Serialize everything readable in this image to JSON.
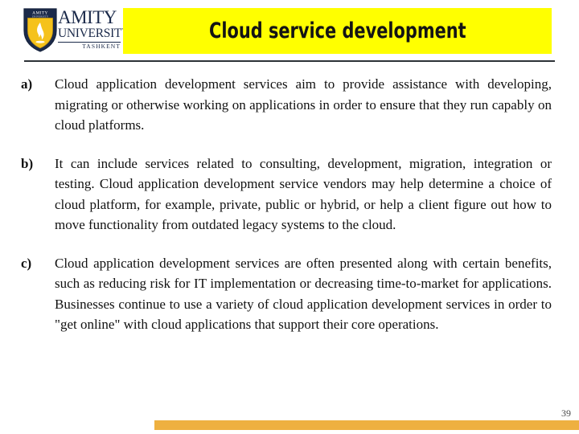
{
  "header": {
    "logo": {
      "name": "amity-university-tashkent-logo",
      "line1": "AMITY",
      "line2": "UNIVERSITY",
      "line3": "TASHKENT",
      "shield_badge_top": "AMITY",
      "shield_badge_sub": "UNIVERSITY",
      "colors": {
        "shield_navy": "#1b2a4a",
        "shield_gold": "#f5c21b",
        "flame_white": "#ffffff"
      }
    },
    "title": "Cloud service development",
    "title_bar_color": "#ffff00",
    "title_text_color": "#141414",
    "rule_color": "#2d3237"
  },
  "content": {
    "items": [
      {
        "marker": "a)",
        "text": "Cloud application development services aim to provide assistance with developing, migrating or otherwise working on applications in order to ensure that they run capably on cloud platforms."
      },
      {
        "marker": "b)",
        "text": "It can include services related to consulting, development, migration, integration or testing. Cloud application development service vendors may help determine a choice of cloud platform, for example, private, public or hybrid, or help a client figure out how to move functionality from outdated legacy systems to the cloud."
      },
      {
        "marker": "c)",
        "text": "Cloud application development services are often presented along with certain benefits, such as reducing risk for IT implementation or decreasing time-to-market for applications. Businesses continue to use a variety of cloud application development services in order to \"get online\" with cloud applications that support their core operations."
      }
    ]
  },
  "footer": {
    "page_number": "39",
    "bar_color": "#eeb040"
  }
}
